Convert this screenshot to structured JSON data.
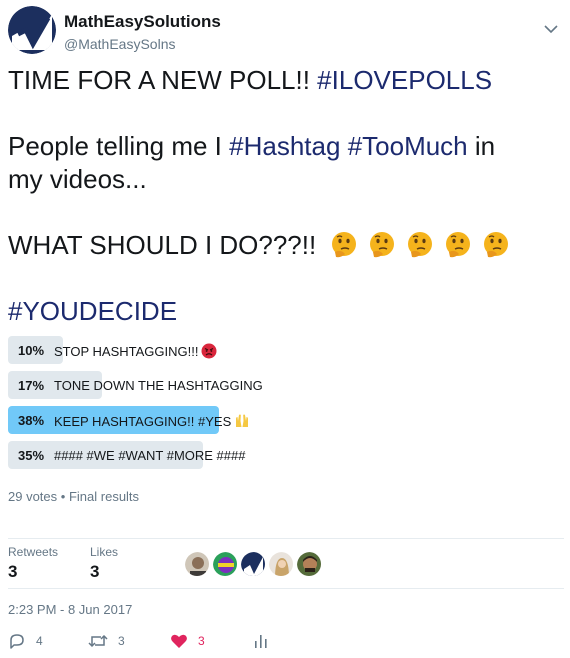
{
  "author": {
    "display_name": "MathEasySolutions",
    "handle": "@MathEasySolns"
  },
  "tweet": {
    "line1_text": "TIME FOR A NEW POLL!! ",
    "line1_hashtag": "#ILOVEPOLLS",
    "line2_text": "People telling me I ",
    "line2_hashtag1": "#Hashtag",
    "line2_space": " ",
    "line2_hashtag2": "#TooMuch",
    "line2_tail": " in",
    "line3_text": "my videos...",
    "line4_text": "WHAT SHOULD I DO???!!",
    "thinking_emoji": "thinking-face-emoji",
    "line5_hashtag": "#YOUDECIDE"
  },
  "poll": {
    "options": [
      {
        "percent": "10%",
        "fraction": 0.1,
        "label": "STOP HASHTAGGING!!!",
        "emoji": "angry-face-emoji"
      },
      {
        "percent": "17%",
        "fraction": 0.17,
        "label": "TONE DOWN THE HASHTAGGING"
      },
      {
        "percent": "38%",
        "fraction": 0.38,
        "label": "KEEP HASHTAGGING!! #YES",
        "emoji": "raised-hands-emoji",
        "winner": true
      },
      {
        "percent": "35%",
        "fraction": 0.35,
        "label": "#### #WE #WANT #MORE ####"
      }
    ],
    "votes": "29 votes",
    "separator": "•",
    "status": "Final results"
  },
  "stats": {
    "retweets_label": "Retweets",
    "retweets_value": "3",
    "likes_label": "Likes",
    "likes_value": "3"
  },
  "timestamp": "2:23 PM - 8 Jun 2017",
  "actions": {
    "reply_count": "4",
    "retweet_count": "3",
    "like_count": "3"
  },
  "colors": {
    "hashtag": "#1c2a6e",
    "poll_bar": "#e1e8ed",
    "poll_bar_winner": "#71c9f8",
    "like": "#e0245e",
    "muted": "#657786"
  },
  "icons": {
    "chevron": "chevron-down-icon",
    "reply": "reply-icon",
    "retweet": "retweet-icon",
    "like": "heart-icon",
    "analytics": "analytics-icon"
  }
}
